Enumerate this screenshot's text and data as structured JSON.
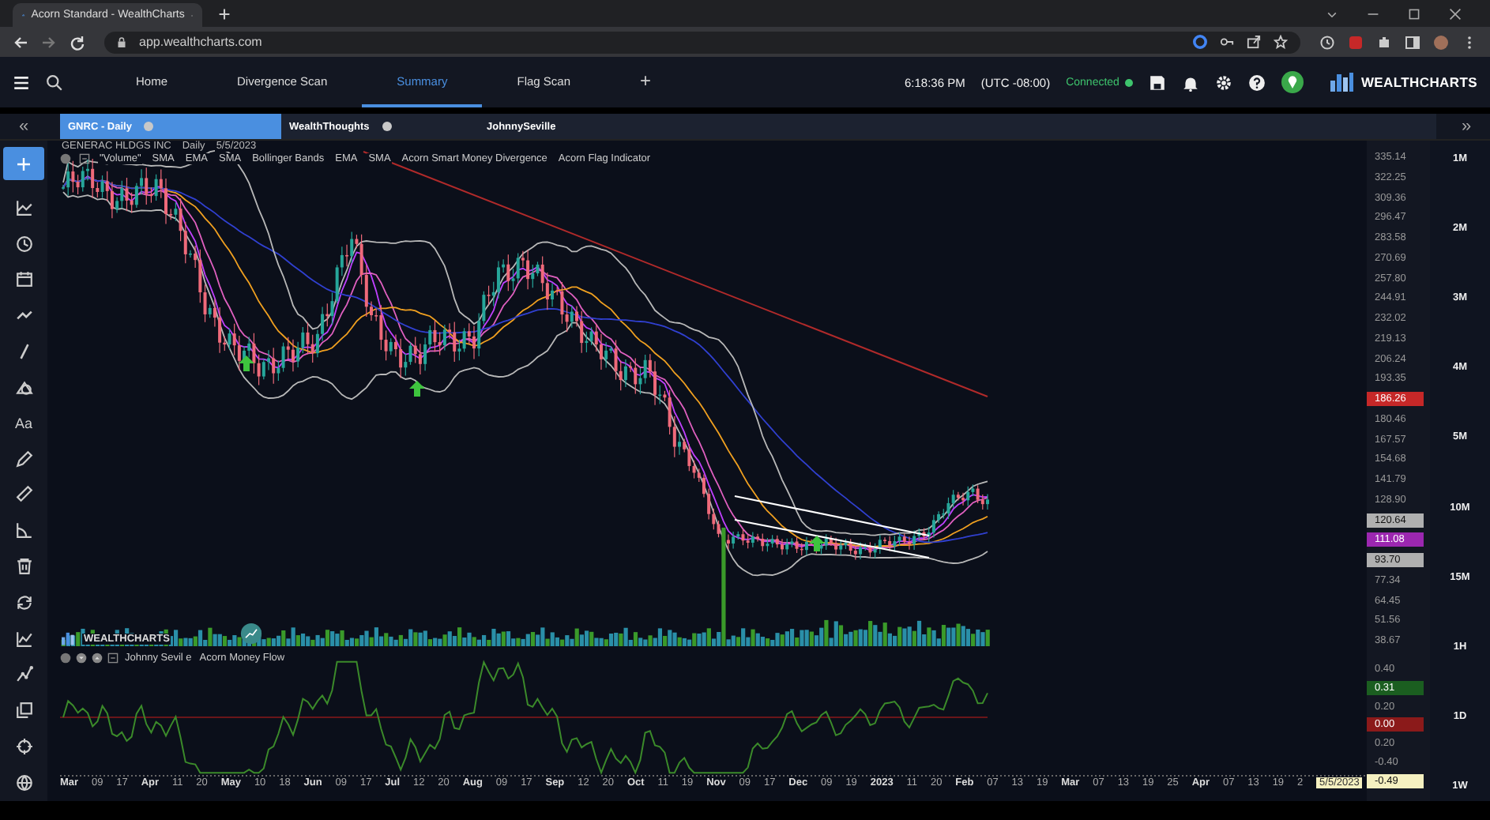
{
  "browser": {
    "tab_title": "Acorn Standard - WealthCharts",
    "url": "app.wealthcharts.com"
  },
  "nav": {
    "tabs": [
      {
        "label": "Home",
        "selected": false
      },
      {
        "label": "Divergence Scan",
        "selected": false
      },
      {
        "label": "Summary",
        "selected": true
      },
      {
        "label": "Flag Scan",
        "selected": false
      }
    ],
    "add_tab": "+",
    "time": "6:18:36 PM",
    "timezone": "(UTC -08:00)",
    "status": "Connected",
    "logo": "WEALTHCHARTS"
  },
  "chart_tabs": [
    {
      "label": "GNRC - Daily",
      "selected": true,
      "closable": true
    },
    {
      "label": "WealthThoughts",
      "selected": false,
      "closable": true
    },
    {
      "label": "JohnnySeville",
      "selected": false,
      "closable": false
    }
  ],
  "toolbar": {
    "draw_selected": true,
    "text_tool": "Aa"
  },
  "chart": {
    "symbol": "GENERAC HLDGS INC",
    "interval": "Daily",
    "date": "5/5/2023",
    "indicators": [
      "\"Volume\"",
      "SMA",
      "EMA",
      "SMA",
      "Bollinger Bands",
      "EMA",
      "SMA",
      "Acorn Smart Money Divergence",
      "Acorn Flag Indicator"
    ],
    "watermark": "WEALTHCHARTS",
    "lower_pane_author": "Johnny Sevil e",
    "lower_pane_title": "Acorn Money Flow",
    "price_axis": [
      {
        "kind": "tick",
        "label": "335.14"
      },
      {
        "kind": "tick",
        "label": "322.25"
      },
      {
        "kind": "tick",
        "label": "309.36"
      },
      {
        "kind": "tick",
        "label": "296.47"
      },
      {
        "kind": "tick",
        "label": "283.58"
      },
      {
        "kind": "tick",
        "label": "270.69"
      },
      {
        "kind": "tick",
        "label": "257.80"
      },
      {
        "kind": "tick",
        "label": "244.91"
      },
      {
        "kind": "tick",
        "label": "232.02"
      },
      {
        "kind": "tick",
        "label": "219.13"
      },
      {
        "kind": "tick",
        "label": "206.24"
      },
      {
        "kind": "tick",
        "label": "193.35"
      },
      {
        "kind": "badge",
        "label": "186.26",
        "color": "#c62828"
      },
      {
        "kind": "tick",
        "label": "180.46"
      },
      {
        "kind": "tick",
        "label": "167.57"
      },
      {
        "kind": "tick",
        "label": "154.68"
      },
      {
        "kind": "tick",
        "label": "141.79"
      },
      {
        "kind": "tick",
        "label": "128.90"
      },
      {
        "kind": "badge",
        "label": "120.64",
        "color": "#b0b0b0"
      },
      {
        "kind": "badge",
        "label": "111.08",
        "color": "#9c27b0"
      },
      {
        "kind": "badge",
        "label": "93.70",
        "color": "#b0b0b0"
      },
      {
        "kind": "tick",
        "label": "77.34"
      },
      {
        "kind": "tick",
        "label": "64.45"
      },
      {
        "kind": "tick",
        "label": "51.56"
      },
      {
        "kind": "tick",
        "label": "38.67"
      }
    ],
    "flow_axis": [
      {
        "kind": "tick",
        "label": "0.40"
      },
      {
        "kind": "badge",
        "label": "0.31",
        "color": "#1b5e20"
      },
      {
        "kind": "tick",
        "label": "0.20"
      },
      {
        "kind": "badge",
        "label": "0.00",
        "color": "#8b1a1a"
      },
      {
        "kind": "tick",
        "label": "0.20"
      },
      {
        "kind": "tick",
        "label": "-0.40"
      },
      {
        "kind": "badge",
        "label": "-0.49",
        "color": "#f5f0c0"
      }
    ],
    "time_axis": [
      {
        "kind": "month",
        "label": "Mar"
      },
      {
        "kind": "day",
        "label": "09"
      },
      {
        "kind": "day",
        "label": "17"
      },
      {
        "kind": "month",
        "label": "Apr"
      },
      {
        "kind": "day",
        "label": "11"
      },
      {
        "kind": "day",
        "label": "20"
      },
      {
        "kind": "month",
        "label": "May"
      },
      {
        "kind": "day",
        "label": "10"
      },
      {
        "kind": "day",
        "label": "18"
      },
      {
        "kind": "month",
        "label": "Jun"
      },
      {
        "kind": "day",
        "label": "09"
      },
      {
        "kind": "day",
        "label": "17"
      },
      {
        "kind": "month",
        "label": "Jul"
      },
      {
        "kind": "day",
        "label": "12"
      },
      {
        "kind": "day",
        "label": "20"
      },
      {
        "kind": "month",
        "label": "Aug"
      },
      {
        "kind": "day",
        "label": "09"
      },
      {
        "kind": "day",
        "label": "17"
      },
      {
        "kind": "month",
        "label": "Sep"
      },
      {
        "kind": "day",
        "label": "12"
      },
      {
        "kind": "day",
        "label": "20"
      },
      {
        "kind": "month",
        "label": "Oct"
      },
      {
        "kind": "day",
        "label": "11"
      },
      {
        "kind": "day",
        "label": "19"
      },
      {
        "kind": "month",
        "label": "Nov"
      },
      {
        "kind": "day",
        "label": "09"
      },
      {
        "kind": "day",
        "label": "17"
      },
      {
        "kind": "month",
        "label": "Dec"
      },
      {
        "kind": "day",
        "label": "09"
      },
      {
        "kind": "day",
        "label": "19"
      },
      {
        "kind": "month",
        "label": "2023"
      },
      {
        "kind": "day",
        "label": "11"
      },
      {
        "kind": "day",
        "label": "20"
      },
      {
        "kind": "month",
        "label": "Feb"
      },
      {
        "kind": "day",
        "label": "07"
      },
      {
        "kind": "day",
        "label": "13"
      },
      {
        "kind": "day",
        "label": "19"
      },
      {
        "kind": "month",
        "label": "Mar"
      },
      {
        "kind": "day",
        "label": "07"
      },
      {
        "kind": "day",
        "label": "13"
      },
      {
        "kind": "day",
        "label": "19"
      },
      {
        "kind": "day",
        "label": "25"
      },
      {
        "kind": "month",
        "label": "Apr"
      },
      {
        "kind": "day",
        "label": "07"
      },
      {
        "kind": "day",
        "label": "13"
      },
      {
        "kind": "day",
        "label": "19"
      },
      {
        "kind": "day",
        "label": "2"
      }
    ],
    "cursor_date": "5/5/2023"
  },
  "timeframes": [
    {
      "label": "1M"
    },
    {
      "label": "2M"
    },
    {
      "label": "3M"
    },
    {
      "label": "4M"
    },
    {
      "label": "5M"
    },
    {
      "label": "10M"
    },
    {
      "label": "15M"
    },
    {
      "label": "1H"
    },
    {
      "label": "1D"
    },
    {
      "label": "1W"
    }
  ],
  "collapse_left": "«",
  "collapse_right": "»"
}
